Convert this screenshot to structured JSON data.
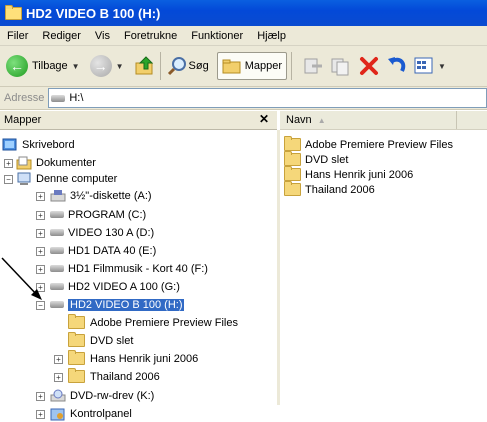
{
  "window": {
    "title": "HD2 VIDEO B 100 (H:)"
  },
  "menu": [
    "Filer",
    "Rediger",
    "Vis",
    "Foretrukne",
    "Funktioner",
    "Hjælp"
  ],
  "toolbar": {
    "back_label": "Tilbage",
    "search_label": "Søg",
    "folders_label": "Mapper"
  },
  "address": {
    "label": "Adresse",
    "value": "H:\\"
  },
  "left_pane": {
    "title": "Mapper"
  },
  "tree": [
    {
      "label": "Skrivebord"
    },
    {
      "label": "Dokumenter"
    },
    {
      "label": "Denne computer"
    },
    {
      "label": "3½\"-diskette (A:)"
    },
    {
      "label": "PROGRAM (C:)"
    },
    {
      "label": "VIDEO 130 A (D:)"
    },
    {
      "label": "HD1 DATA 40 (E:)"
    },
    {
      "label": "HD1 Filmmusik - Kort 40 (F:)"
    },
    {
      "label": "HD2 VIDEO A 100 (G:)"
    },
    {
      "label": "HD2 VIDEO B 100 (H:)"
    },
    {
      "label": "Adobe Premiere Preview Files"
    },
    {
      "label": "DVD slet"
    },
    {
      "label": "Hans Henrik juni 2006"
    },
    {
      "label": "Thailand 2006"
    },
    {
      "label": "DVD-rw-drev (K:)"
    },
    {
      "label": "Kontrolpanel"
    }
  ],
  "right_pane": {
    "column_name": "Navn",
    "files": [
      {
        "label": "Adobe Premiere Preview Files"
      },
      {
        "label": "DVD slet"
      },
      {
        "label": "Hans Henrik juni 2006"
      },
      {
        "label": "Thailand 2006"
      }
    ]
  }
}
